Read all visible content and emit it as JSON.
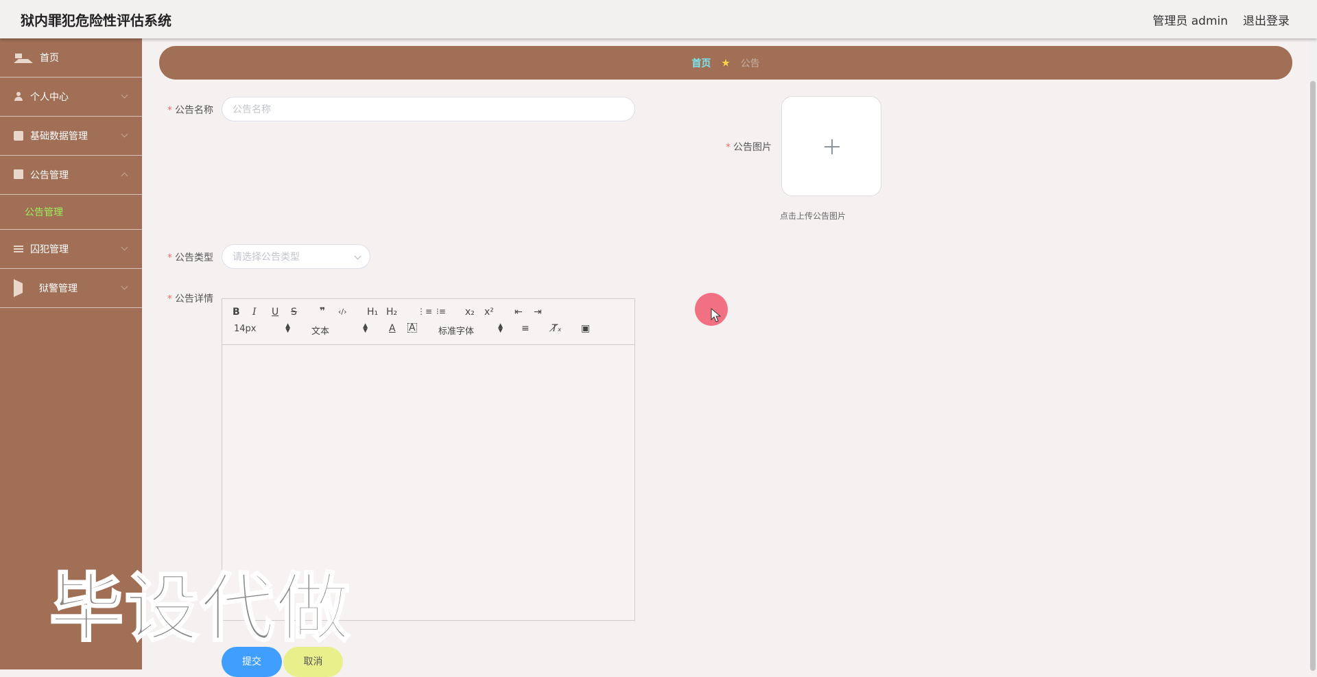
{
  "header": {
    "title": "狱内罪犯危险性评估系统",
    "user": "管理员 admin",
    "logout": "退出登录"
  },
  "sidebar": {
    "items": [
      {
        "label": "首页",
        "icon": "home-icon"
      },
      {
        "label": "个人中心",
        "icon": "user-icon"
      },
      {
        "label": "基础数据管理",
        "icon": "data-icon"
      },
      {
        "label": "公告管理",
        "icon": "monitor-icon",
        "expanded": true,
        "children": [
          {
            "label": "公告管理"
          }
        ]
      },
      {
        "label": "囚犯管理",
        "icon": "list-icon"
      },
      {
        "label": "狱警管理",
        "icon": "plane-icon"
      }
    ]
  },
  "breadcrumb": {
    "home": "首页",
    "current": "公告"
  },
  "form": {
    "name_label": "公告名称",
    "name_placeholder": "公告名称",
    "image_label": "公告图片",
    "image_tip": "点击上传公告图片",
    "type_label": "公告类型",
    "type_placeholder": "请选择公告类型",
    "detail_label": "公告详情",
    "required_mark": "*"
  },
  "editor": {
    "font_size": "14px",
    "header_select": "文本",
    "font_family": "标准字体",
    "buttons": {
      "bold": "B",
      "italic": "I",
      "underline": "U",
      "strike": "S",
      "quote": "❞",
      "code": "‹/›",
      "h1": "H₁",
      "h2": "H₂",
      "ordered": "⋮≡",
      "bullet": "⁝≡",
      "sub": "x₂",
      "sup": "x²",
      "outdent": "⇤",
      "indent": "⇥",
      "color": "A",
      "bg": "A",
      "align": "≡",
      "clean": "T̸ₓ",
      "image": "▣"
    }
  },
  "actions": {
    "submit": "提交",
    "cancel": "取消"
  },
  "watermark": "毕设代做",
  "colors": {
    "sidebar": "#a06f56",
    "breadcrumb_home": "#7be5f0",
    "active_submenu": "#9ef05a",
    "submit": "#409eff",
    "cancel": "#e9ef8a"
  }
}
